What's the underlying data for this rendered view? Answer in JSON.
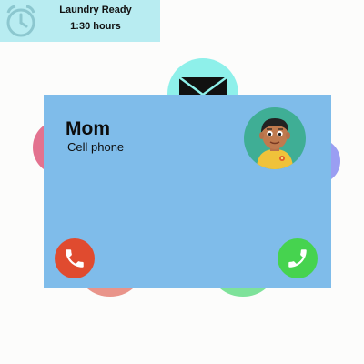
{
  "notification": {
    "title": "Laundry Ready",
    "subtitle": "1:30 hours",
    "icon": "alarm-clock-icon"
  },
  "call": {
    "caller_name": "Mom",
    "caller_type": "Cell phone",
    "avatar_icon": "avatar",
    "decline_icon": "phone-decline-icon",
    "accept_icon": "phone-accept-icon"
  },
  "quick_actions": {
    "message_icon": "envelope-icon"
  },
  "colors": {
    "banner": "#b8ecf1",
    "card": "#7fbcea",
    "decline": "#e04b2f",
    "accept": "#46d34f",
    "circle_top": "#8ef0ea",
    "circle_left": "#e3728f",
    "circle_right": "#9a9ef2",
    "circle_bottom_left": "#e9948a",
    "circle_bottom_right": "#7ee29a"
  }
}
